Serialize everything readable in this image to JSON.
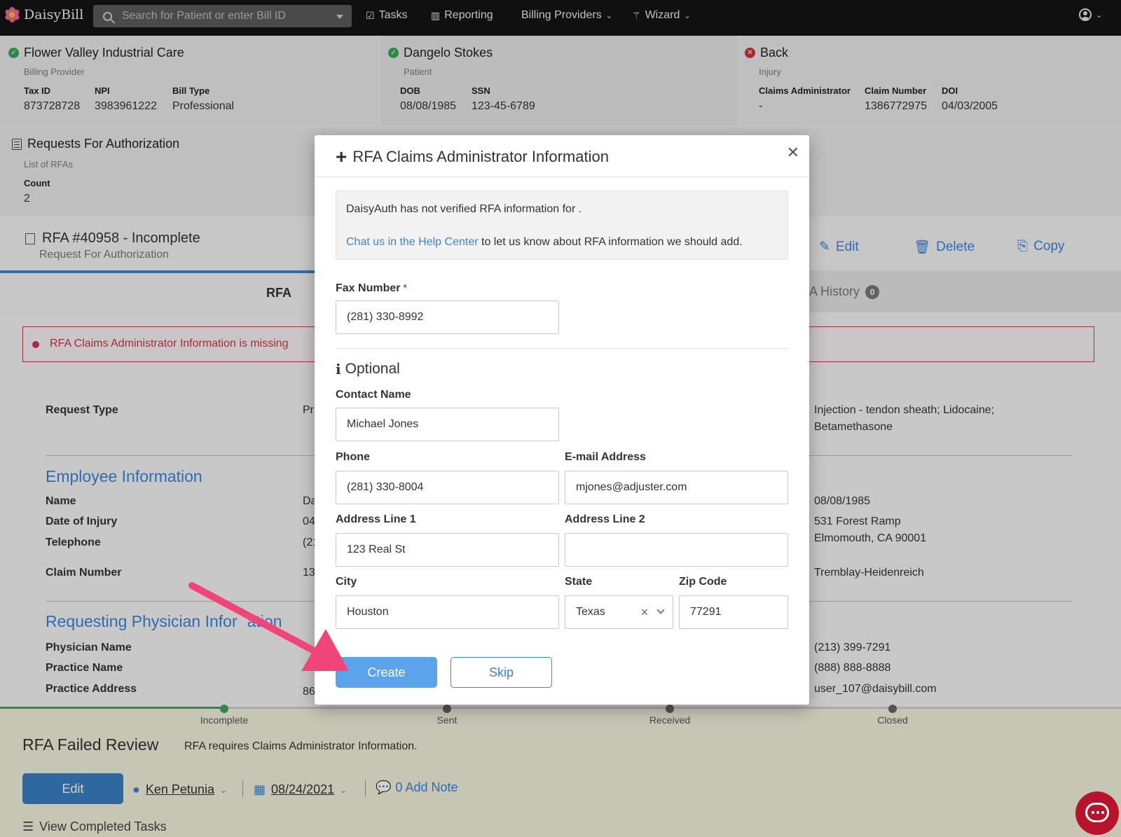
{
  "app": {
    "name": "DaisyBill"
  },
  "nav": {
    "search_placeholder": "Search for Patient or enter Bill ID",
    "tasks": "Tasks",
    "reporting": "Reporting",
    "billing_providers": "Billing Providers",
    "wizard": "Wizard"
  },
  "header_cards": {
    "provider": {
      "title": "Flower Valley Industrial Care",
      "subtitle": "Billing Provider",
      "tax_id_label": "Tax ID",
      "tax_id": "873728728",
      "npi_label": "NPI",
      "npi": "3983961222",
      "bill_type_label": "Bill Type",
      "bill_type": "Professional"
    },
    "patient": {
      "title": "Dangelo Stokes",
      "subtitle": "Patient",
      "dob_label": "DOB",
      "dob": "08/08/1985",
      "ssn_label": "SSN",
      "ssn": "123-45-6789"
    },
    "injury": {
      "title": "Back",
      "subtitle": "Injury",
      "claims_admin_label": "Claims Administrator",
      "claims_admin": "-",
      "claim_number_label": "Claim Number",
      "claim_number": "1386772975",
      "doi_label": "DOI",
      "doi": "04/03/2005"
    }
  },
  "rfa_list": {
    "title": "Requests For Authorization",
    "subtitle": "List of RFAs",
    "count_label": "Count",
    "count": "2"
  },
  "rfa": {
    "title": "RFA #40958 - Incomplete",
    "subtitle": "Request For Authorization",
    "edit": "Edit",
    "delete": "Delete",
    "copy": "Copy",
    "tab_rfa": "RFA",
    "tab_history": "A History",
    "history_count": "0",
    "alert": "RFA Claims Administrator Information is missing",
    "request_type_label": "Request Type",
    "request_type_partial": "Pr",
    "procedure_line1": "Injection - tendon sheath; Lidocaine;",
    "procedure_line2": "Betamethasone",
    "employee_section": "Employee Information",
    "name_label": "Name",
    "name_partial": "Da",
    "dob_value": "08/08/1985",
    "doi_label": "Date of Injury",
    "doi_partial": "04",
    "address_line1": "531 Forest Ramp",
    "address_line2": "Elmomouth, CA 90001",
    "telephone_label": "Telephone",
    "telephone_partial": "(21",
    "claim_label": "Claim Number",
    "claim_partial": "13",
    "employer": "Tremblay-Heidenreich",
    "physician_section": "Requesting Physician Infor",
    "physician_section_tail": "ation",
    "physician_name_label": "Physician Name",
    "physician_phone": "(213) 399-7291",
    "practice_name_label": "Practice Name",
    "practice_phone": "(888) 888-8888",
    "practice_address_label": "Practice Address",
    "practice_address_partial": "86",
    "practice_email": "user_107@daisybill.com"
  },
  "bottom": {
    "steps": [
      "Incomplete",
      "Sent",
      "Received",
      "Closed"
    ],
    "title": "RFA Failed Review",
    "message": "RFA requires Claims Administrator Information.",
    "edit": "Edit",
    "user": "Ken Petunia",
    "date": "08/24/2021",
    "note": "0 Add Note",
    "view_tasks": "View Completed Tasks"
  },
  "modal": {
    "title": "RFA Claims Administrator Information",
    "info_line1": "DaisyAuth has not verified RFA information for .",
    "info_link": "Chat us in the Help Center",
    "info_line2": " to let us know about RFA information we should add.",
    "fax_label": "Fax Number",
    "fax_value": "(281) 330-8992",
    "optional": "Optional",
    "contact_label": "Contact Name",
    "contact_value": "Michael Jones",
    "phone_label": "Phone",
    "phone_value": "(281) 330-8004",
    "email_label": "E-mail Address",
    "email_value": "mjones@adjuster.com",
    "addr1_label": "Address Line 1",
    "addr1_value": "123 Real St",
    "addr2_label": "Address Line 2",
    "addr2_value": "",
    "city_label": "City",
    "city_value": "Houston",
    "state_label": "State",
    "state_value": "Texas",
    "zip_label": "Zip Code",
    "zip_value": "77291",
    "create": "Create",
    "skip": "Skip"
  },
  "colors": {
    "accent": "#3a84d6",
    "error": "#d0343b",
    "annotation_arrow": "#f1457a"
  }
}
